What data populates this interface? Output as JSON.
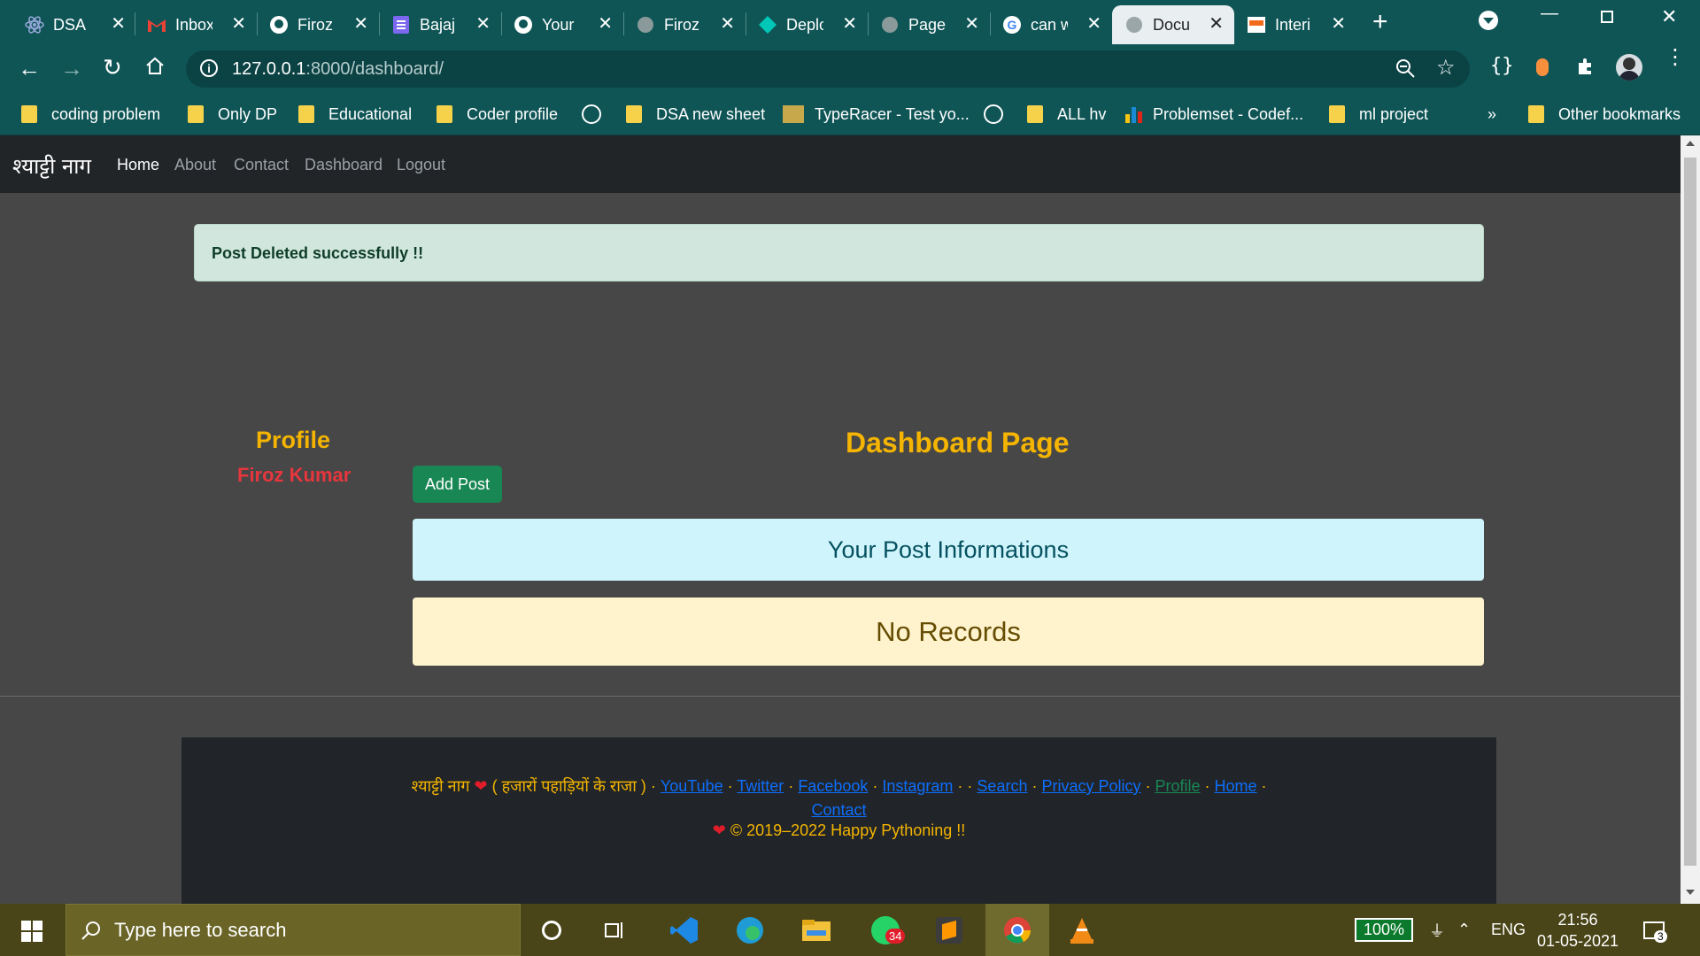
{
  "browser": {
    "tabs": [
      {
        "title": "DSA I",
        "icon": "react-icon"
      },
      {
        "title": "Inbox",
        "icon": "gmail-icon"
      },
      {
        "title": "Firoz",
        "icon": "github-icon"
      },
      {
        "title": "Bajaj",
        "icon": "forms-icon"
      },
      {
        "title": "Your",
        "icon": "github-icon"
      },
      {
        "title": "Firoz",
        "icon": "globe-icon"
      },
      {
        "title": "Deplo",
        "icon": "diamond-icon"
      },
      {
        "title": "Page",
        "icon": "globe-icon"
      },
      {
        "title": "can w",
        "icon": "google-icon"
      },
      {
        "title": "Docu",
        "icon": "globe-icon",
        "active": true
      },
      {
        "title": "Interi",
        "icon": "site-icon"
      }
    ],
    "address": {
      "host": "127.0.0.1",
      "rest": ":8000/dashboard/"
    },
    "bookmarks": [
      {
        "label": "coding problem",
        "icon": "folder-icon"
      },
      {
        "label": "Only DP",
        "icon": "folder-icon"
      },
      {
        "label": "Educational",
        "icon": "folder-icon"
      },
      {
        "label": "Coder profile",
        "icon": "folder-icon"
      },
      {
        "label": "",
        "icon": "globe-icon"
      },
      {
        "label": "DSA new sheet",
        "icon": "folder-icon"
      },
      {
        "label": "TypeRacer - Test yo...",
        "icon": "typeracer-icon"
      },
      {
        "label": "",
        "icon": "globe-icon"
      },
      {
        "label": "ALL hv",
        "icon": "folder-icon"
      },
      {
        "label": "Problemset - Codef...",
        "icon": "codeforces-icon"
      },
      {
        "label": "ml project",
        "icon": "folder-icon"
      }
    ],
    "bookmarks_more": "»",
    "other_bookmarks": "Other bookmarks"
  },
  "site": {
    "brand": "श्याट्टी नाग",
    "nav": [
      "Home",
      "About",
      "Contact",
      "Dashboard",
      "Logout"
    ],
    "alert": "Post Deleted successfully !!",
    "profile_heading": "Profile",
    "profile_name": "Firoz Kumar",
    "dashboard_heading": "Dashboard Page",
    "add_post": "Add Post",
    "post_info": "Your Post Informations",
    "no_records": "No Records",
    "footer": {
      "brand": "श्याट्टी नाग",
      "tagline": "( हजारों पहाड़ियों के राजा )",
      "links": [
        "YouTube",
        "Twitter",
        "Facebook",
        "Instagram",
        "Search",
        "Privacy Policy",
        "Profile",
        "Home",
        "Contact"
      ],
      "copyright": "© 2019–2022 Happy Pythoning !!"
    }
  },
  "taskbar": {
    "search_placeholder": "Type here to search",
    "whatsapp_badge": "34",
    "battery": "100%",
    "lang": "ENG",
    "time": "21:56",
    "date": "01-05-2021",
    "notifications": "3"
  }
}
